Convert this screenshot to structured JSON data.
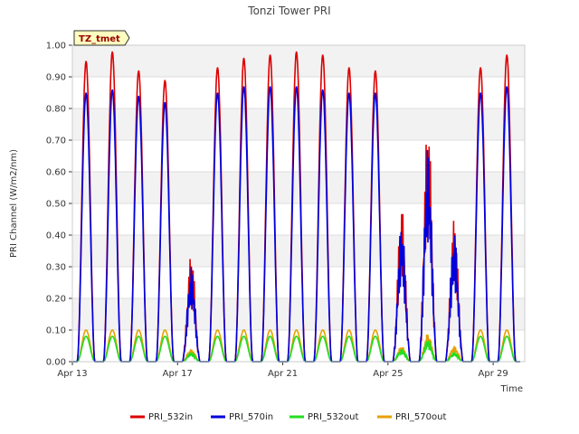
{
  "chart_data": {
    "type": "line",
    "title": "Tonzi Tower PRI",
    "xlabel": "Time",
    "ylabel": "PRI Channel (W/m2/nm)",
    "ylim": [
      0,
      1.0
    ],
    "xlim": [
      13,
      30.2
    ],
    "y_ticks": [
      "0.00",
      "0.10",
      "0.20",
      "0.30",
      "0.40",
      "0.50",
      "0.60",
      "0.70",
      "0.80",
      "0.90",
      "1.00"
    ],
    "x_ticks": [
      {
        "day": 13,
        "label": "Apr 13"
      },
      {
        "day": 17,
        "label": "Apr 17"
      },
      {
        "day": 21,
        "label": "Apr 21"
      },
      {
        "day": 25,
        "label": "Apr 25"
      },
      {
        "day": 29,
        "label": "Apr 29"
      }
    ],
    "grid": "horizontal bands",
    "legend_position": "bottom",
    "tag_label": "TZ_tmet",
    "series": [
      {
        "name": "PRI_532in",
        "color": "#dd0000"
      },
      {
        "name": "PRI_570in",
        "color": "#0000dd"
      },
      {
        "name": "PRI_532out",
        "color": "#22dd22"
      },
      {
        "name": "PRI_570out",
        "color": "#e8a000"
      }
    ],
    "daily_peaks": [
      {
        "date": "Apr 13",
        "PRI_532in": 0.95,
        "PRI_570in": 0.85,
        "PRI_532out": 0.08,
        "PRI_570out": 0.1
      },
      {
        "date": "Apr 14",
        "PRI_532in": 0.98,
        "PRI_570in": 0.86,
        "PRI_532out": 0.08,
        "PRI_570out": 0.1
      },
      {
        "date": "Apr 15",
        "PRI_532in": 0.92,
        "PRI_570in": 0.84,
        "PRI_532out": 0.08,
        "PRI_570out": 0.1
      },
      {
        "date": "Apr 16",
        "PRI_532in": 0.89,
        "PRI_570in": 0.82,
        "PRI_532out": 0.08,
        "PRI_570out": 0.1
      },
      {
        "date": "Apr 17",
        "PRI_532in": 0.34,
        "PRI_570in": 0.3,
        "PRI_532out": 0.03,
        "PRI_570out": 0.04
      },
      {
        "date": "Apr 18",
        "PRI_532in": 0.93,
        "PRI_570in": 0.85,
        "PRI_532out": 0.08,
        "PRI_570out": 0.1
      },
      {
        "date": "Apr 19",
        "PRI_532in": 0.96,
        "PRI_570in": 0.87,
        "PRI_532out": 0.08,
        "PRI_570out": 0.1
      },
      {
        "date": "Apr 20",
        "PRI_532in": 0.97,
        "PRI_570in": 0.87,
        "PRI_532out": 0.08,
        "PRI_570out": 0.1
      },
      {
        "date": "Apr 21",
        "PRI_532in": 0.98,
        "PRI_570in": 0.87,
        "PRI_532out": 0.08,
        "PRI_570out": 0.1
      },
      {
        "date": "Apr 22",
        "PRI_532in": 0.97,
        "PRI_570in": 0.86,
        "PRI_532out": 0.08,
        "PRI_570out": 0.1
      },
      {
        "date": "Apr 23",
        "PRI_532in": 0.93,
        "PRI_570in": 0.85,
        "PRI_532out": 0.08,
        "PRI_570out": 0.1
      },
      {
        "date": "Apr 24",
        "PRI_532in": 0.92,
        "PRI_570in": 0.85,
        "PRI_532out": 0.08,
        "PRI_570out": 0.1
      },
      {
        "date": "Apr 25",
        "PRI_532in": 0.49,
        "PRI_570in": 0.44,
        "PRI_532out": 0.04,
        "PRI_570out": 0.05
      },
      {
        "date": "Apr 26",
        "PRI_532in": 0.76,
        "PRI_570in": 0.68,
        "PRI_532out": 0.07,
        "PRI_570out": 0.09
      },
      {
        "date": "Apr 27",
        "PRI_532in": 0.45,
        "PRI_570in": 0.41,
        "PRI_532out": 0.03,
        "PRI_570out": 0.05
      },
      {
        "date": "Apr 28",
        "PRI_532in": 0.93,
        "PRI_570in": 0.85,
        "PRI_532out": 0.08,
        "PRI_570out": 0.1
      },
      {
        "date": "Apr 29",
        "PRI_532in": 0.97,
        "PRI_570in": 0.87,
        "PRI_532out": 0.08,
        "PRI_570out": 0.1
      }
    ]
  }
}
